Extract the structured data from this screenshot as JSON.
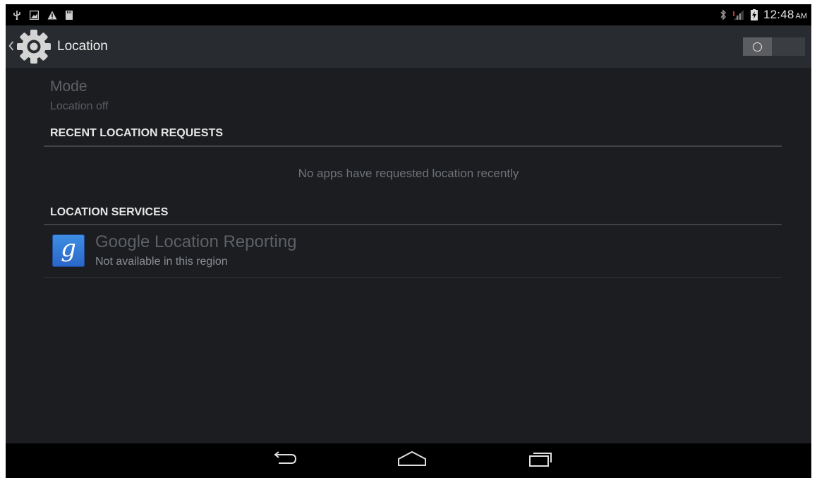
{
  "status_bar": {
    "notification_icons": [
      "usb-icon",
      "image-icon",
      "warning-icon",
      "sd-card-icon"
    ],
    "system_icons": [
      "bluetooth-icon",
      "signal-icon",
      "battery-charging-icon"
    ],
    "time": "12:48",
    "ampm": "AM"
  },
  "action_bar": {
    "title": "Location",
    "icon": "settings-gear-icon",
    "switch_state": "off"
  },
  "mode": {
    "title": "Mode",
    "summary": "Location off"
  },
  "recent_requests": {
    "header": "RECENT LOCATION REQUESTS",
    "empty_text": "No apps have requested location recently"
  },
  "location_services": {
    "header": "LOCATION SERVICES",
    "items": [
      {
        "icon": "google-search-icon",
        "icon_glyph": "g",
        "title": "Google Location Reporting",
        "summary": "Not available in this region"
      }
    ]
  },
  "nav_bar": {
    "buttons": [
      "back-icon",
      "home-icon",
      "recents-icon"
    ]
  },
  "colors": {
    "background": "#1b1d21",
    "action_bar": "#282b2f",
    "accent": "#2a66c9"
  }
}
